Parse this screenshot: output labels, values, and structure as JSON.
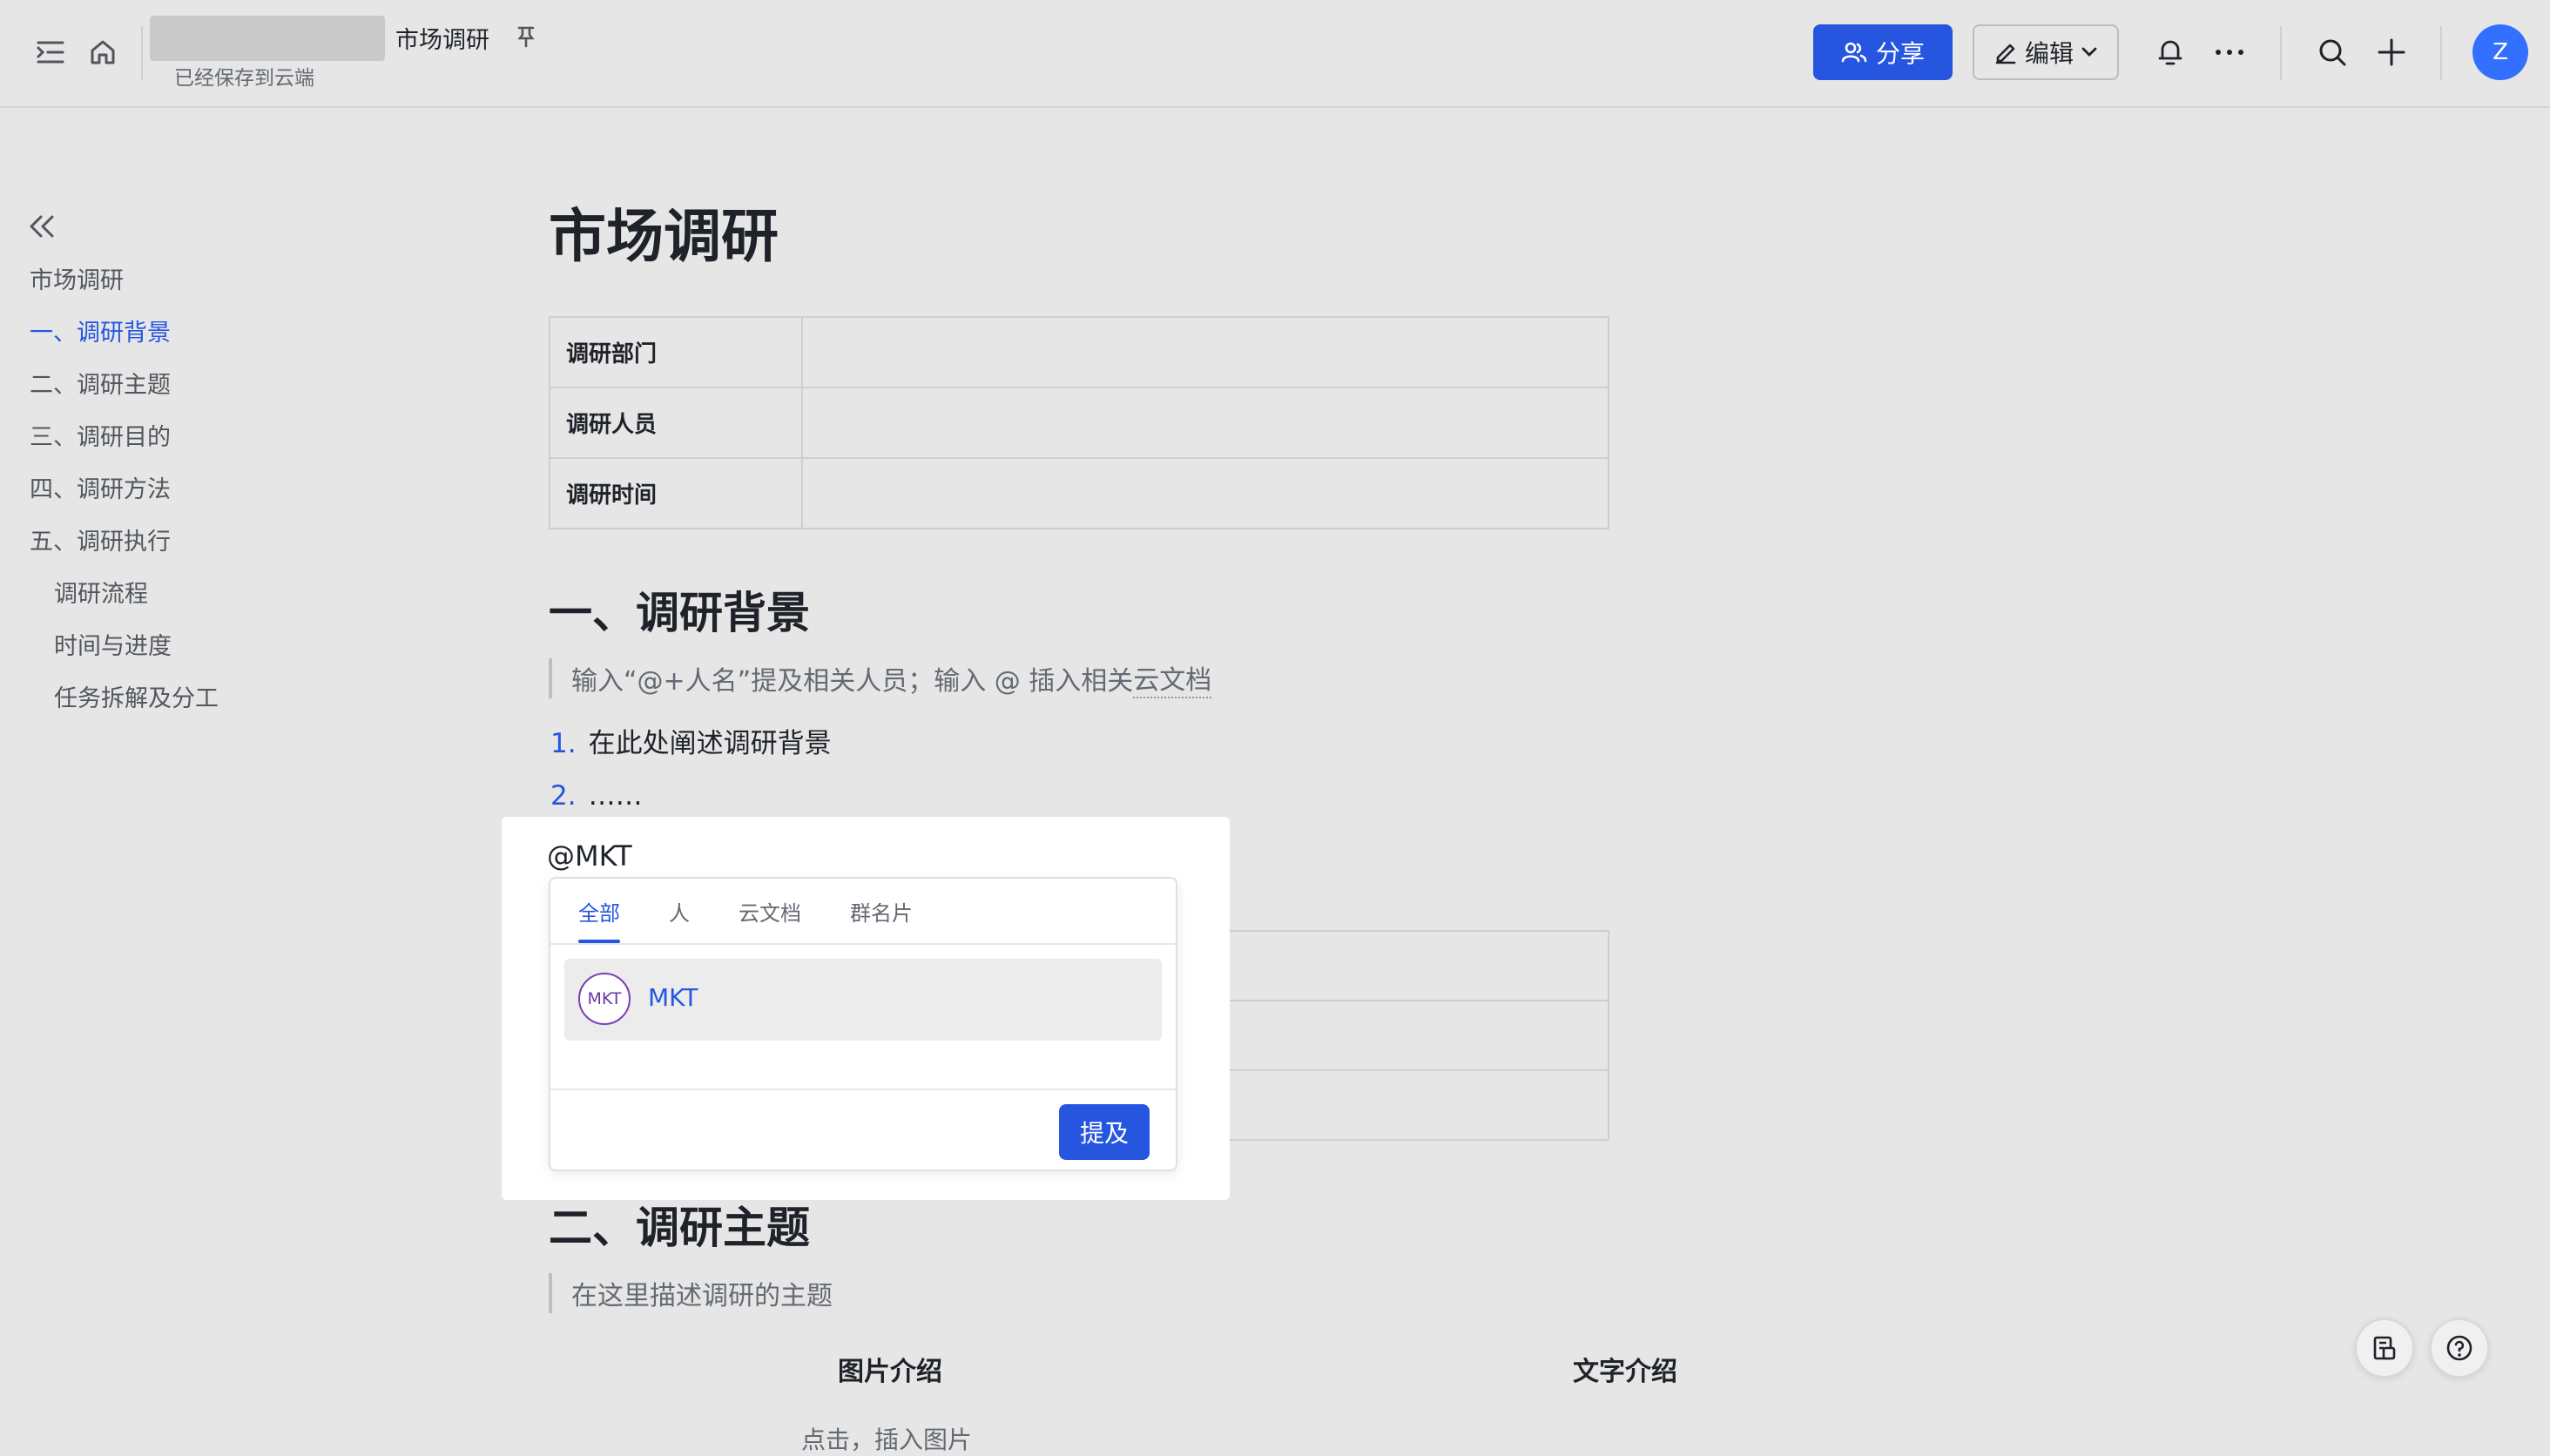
{
  "header": {
    "doc_title": "市场调研",
    "save_status": "已经保存到云端",
    "share_label": "分享",
    "edit_label": "编辑",
    "avatar_initial": "Z"
  },
  "outline": {
    "items": [
      {
        "label": "市场调研"
      },
      {
        "label": "一、调研背景"
      },
      {
        "label": "二、调研主题"
      },
      {
        "label": "三、调研目的"
      },
      {
        "label": "四、调研方法"
      },
      {
        "label": "五、调研执行"
      },
      {
        "label": "调研流程"
      },
      {
        "label": "时间与进度"
      },
      {
        "label": "任务拆解及分工"
      }
    ]
  },
  "document": {
    "title": "市场调研",
    "info_table": [
      {
        "label": "调研部门"
      },
      {
        "label": "调研人员"
      },
      {
        "label": "调研时间"
      }
    ],
    "section1": {
      "heading": "一、调研背景",
      "hint_prefix": "输入“@+人名”提及相关人员；输入 @ 插入相关",
      "hint_link": "云文档",
      "list": [
        {
          "num": "1.",
          "text": "在此处阐述调研背景"
        },
        {
          "num": "2.",
          "text": "……"
        }
      ]
    },
    "section2": {
      "heading": "二、调研主题",
      "hint": "在这里描述调研的主题",
      "col_image": "图片介绍",
      "col_text": "文字介绍",
      "cutoff_text": "点击，插入图片"
    }
  },
  "mention": {
    "query": "@MKT",
    "tabs": [
      "全部",
      "人",
      "云文档",
      "群名片"
    ],
    "active_tab": "全部",
    "result": {
      "avatar_text": "MKT",
      "name": "MKT"
    },
    "submit_label": "提及"
  },
  "colors": {
    "accent": "#2656e0",
    "background": "#e6e6e6",
    "avatar": "#3370ff"
  }
}
